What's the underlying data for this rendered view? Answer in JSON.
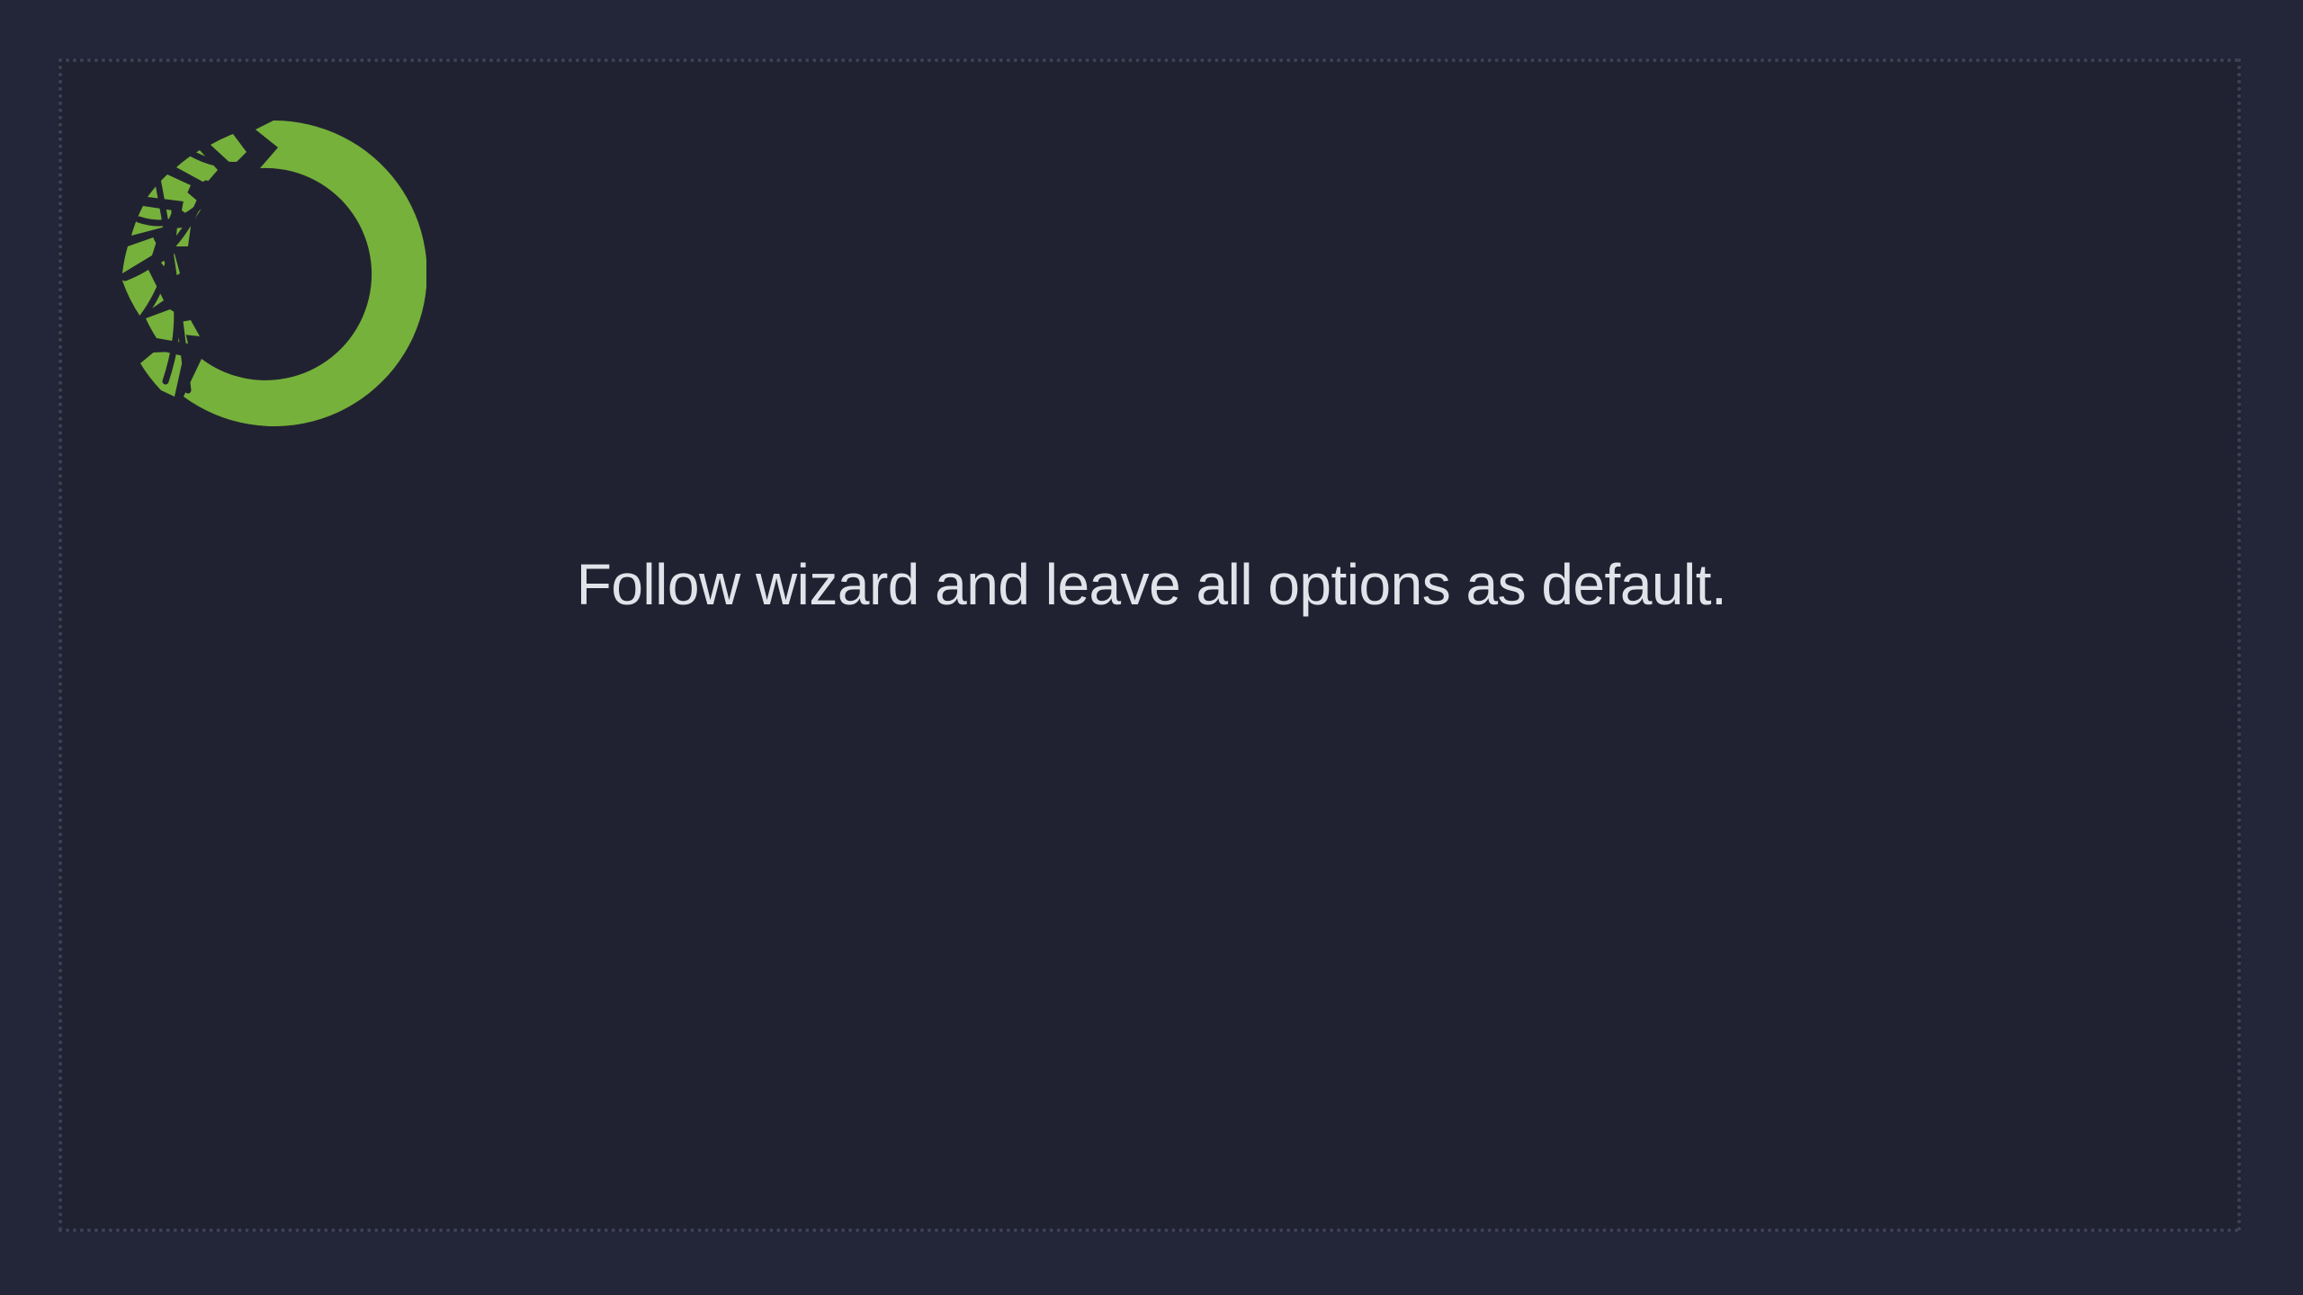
{
  "slide": {
    "instruction_text": "Follow wizard and leave all options as default."
  },
  "logo": {
    "icon": "anaconda-logo-icon",
    "color": "#76b13b"
  },
  "colors": {
    "page_background": "#232538",
    "slide_background": "#212231",
    "frame_border": "#3d4057",
    "text": "#e2e3ea"
  }
}
